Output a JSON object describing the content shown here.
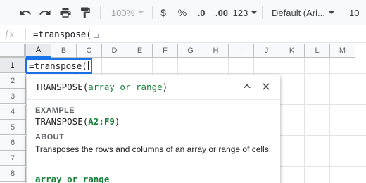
{
  "toolbar": {
    "zoom": "100%",
    "currency": "$",
    "percent": "%",
    "decrease_decimals": ".0",
    "increase_decimals": ".00",
    "more_formats": "123",
    "font_family": "Default (Ari...",
    "font_size": "10"
  },
  "formula_bar": {
    "fx_label": "fx",
    "value": "=transpose("
  },
  "grid": {
    "columns": [
      "A",
      "B",
      "C",
      "D",
      "E",
      "F",
      "G",
      "H",
      "I",
      "J",
      "K",
      "L",
      "M"
    ],
    "rows": [
      "1",
      "2",
      "3",
      "4",
      "5",
      "6",
      "7",
      "8"
    ],
    "active_cell_text": "=transpose("
  },
  "help": {
    "fn_name": "TRANSPOSE(",
    "fn_arg": "array_or_range",
    "fn_close": ")",
    "example_label": "EXAMPLE",
    "example_fn": "TRANSPOSE(",
    "example_arg": "A2:F9",
    "example_close": ")",
    "about_label": "ABOUT",
    "about_text": "Transposes the rows and columns of an array or range of cells.",
    "param_name": "array_or_range"
  },
  "icons": [
    "undo-icon",
    "redo-icon",
    "print-icon",
    "paint-format-icon",
    "collapse-icon",
    "close-icon"
  ],
  "colors": {
    "accent": "#1a73e8",
    "argument": "#188038",
    "toolbar_bg": "#f8f9fa",
    "gridline": "#e2e3e3"
  }
}
